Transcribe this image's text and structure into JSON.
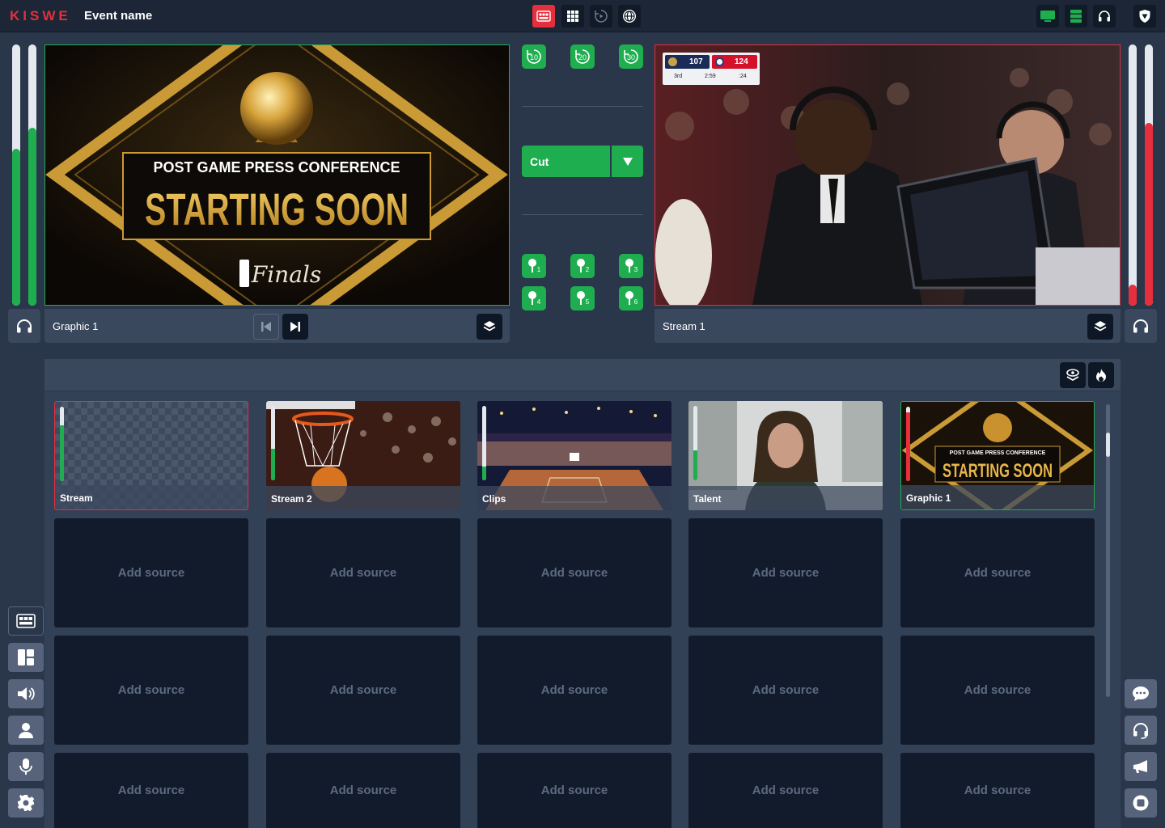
{
  "app": {
    "logo": "KISWE",
    "event_name": "Event name"
  },
  "topbar": {
    "center_icons": [
      "multiview-icon",
      "grid-icon",
      "replay-icon",
      "globe-broadcast-icon"
    ],
    "right_icons": [
      "monitor-icon",
      "server-icon",
      "headset-icon",
      "shield-icon"
    ]
  },
  "preview": {
    "source_label": "Graphic 1",
    "title_line1": "POST GAME PRESS CONFERENCE",
    "title_line2": "STARTING SOON",
    "logo_text": "Finals",
    "meter_levels": [
      0.6,
      0.68
    ]
  },
  "program": {
    "source_label": "Stream 1",
    "meter_levels": [
      0.08,
      0.7
    ]
  },
  "scorebug": {
    "away_score": "107",
    "home_score": "124",
    "period": "3rd",
    "clock": "2:59",
    "shot_clock": ":24"
  },
  "controls": {
    "replay_buttons": [
      "10",
      "20",
      "30"
    ],
    "transition_label": "Cut",
    "pin_buttons": [
      "1",
      "2",
      "3",
      "4",
      "5",
      "6"
    ]
  },
  "sources": [
    {
      "name": "Stream",
      "state": "program",
      "level": 0.75
    },
    {
      "name": "Stream 2",
      "state": "idle",
      "level": 0.42
    },
    {
      "name": "Clips",
      "state": "idle",
      "level": 0.18
    },
    {
      "name": "Talent",
      "state": "idle",
      "level": 0.4
    },
    {
      "name": "Graphic 1",
      "state": "preview",
      "level": 0.92
    }
  ],
  "add_source_label": "Add source",
  "left_sidebar": [
    "multiview-icon",
    "layout-icon",
    "audio-icon",
    "talent-icon",
    "mic-icon",
    "settings-icon"
  ],
  "right_sidebar": [
    "chat-icon",
    "headset-icon",
    "announce-icon",
    "record-icon"
  ],
  "colors": {
    "accent_red": "#e52f3c",
    "accent_green": "#1fae4f",
    "background": "#2a374a"
  }
}
